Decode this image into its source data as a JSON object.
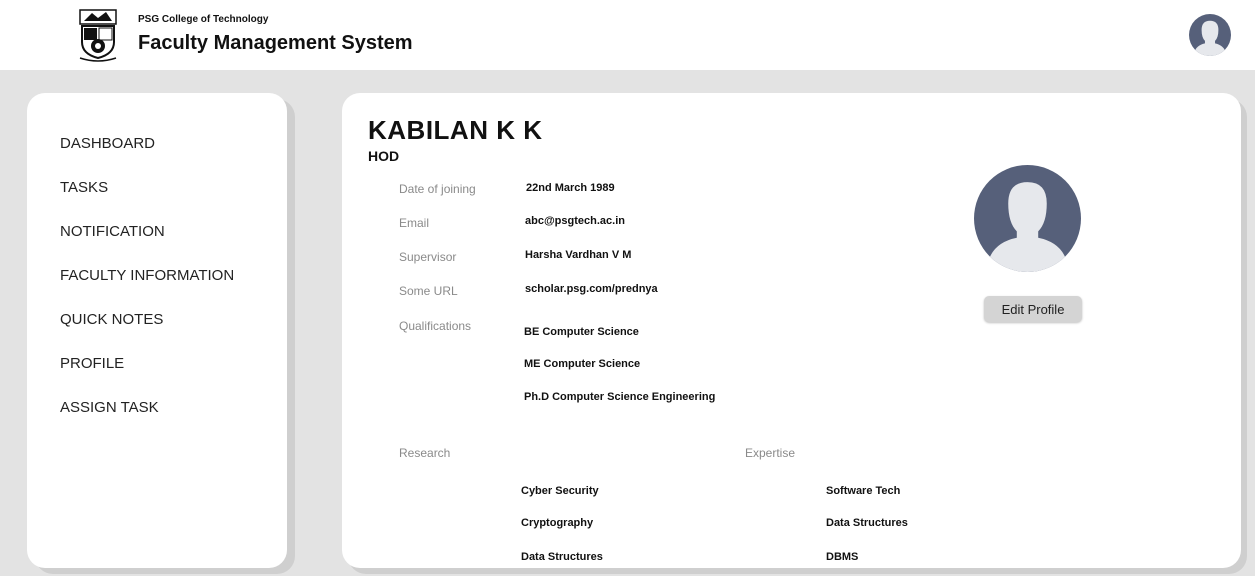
{
  "header": {
    "college": "PSG College of Technology",
    "app_title": "Faculty Management System"
  },
  "sidebar": {
    "items": [
      {
        "label": "DASHBOARD"
      },
      {
        "label": "TASKS"
      },
      {
        "label": "NOTIFICATION"
      },
      {
        "label": "FACULTY INFORMATION"
      },
      {
        "label": "QUICK NOTES"
      },
      {
        "label": "PROFILE"
      },
      {
        "label": "ASSIGN TASK"
      }
    ]
  },
  "profile": {
    "name": "KABILAN K K",
    "role": "HOD",
    "fields": {
      "date_of_joining": {
        "label": "Date of joining",
        "value": "22nd March 1989"
      },
      "email": {
        "label": "Email",
        "value": "abc@psgtech.ac.in"
      },
      "supervisor": {
        "label": "Supervisor",
        "value": "Harsha Vardhan V M"
      },
      "url": {
        "label": "Some URL",
        "value": "scholar.psg.com/prednya"
      }
    },
    "qualifications_label": "Qualifications",
    "qualifications": [
      "BE Computer Science",
      "ME Computer Science",
      "Ph.D Computer Science Engineering"
    ],
    "research_label": "Research",
    "research": [
      "Cyber Security",
      "Cryptography",
      "Data Structures"
    ],
    "expertise_label": "Expertise",
    "expertise": [
      "Software Tech",
      "Data Structures",
      "DBMS"
    ],
    "edit_button": "Edit Profile"
  },
  "colors": {
    "background": "#e3e3e3",
    "avatar": "#56607a",
    "avatar_figure": "#e6e8ec",
    "button": "#d4d4d4"
  }
}
